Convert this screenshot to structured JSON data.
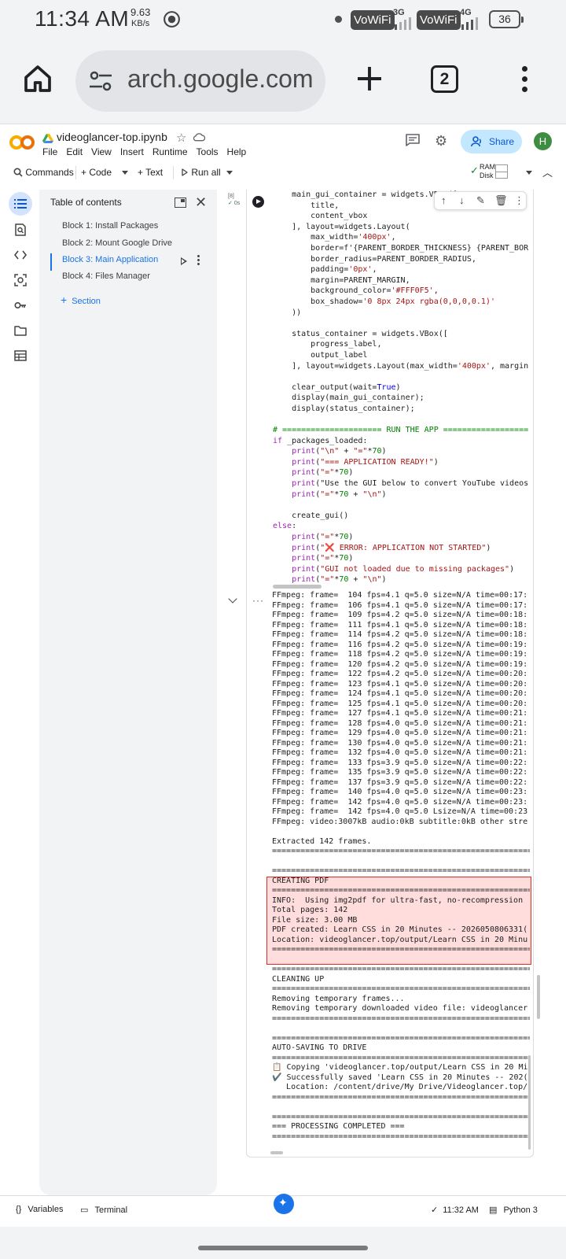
{
  "status_bar": {
    "time": "11:34 AM",
    "net_speed": "9.63",
    "net_unit": "KB/s",
    "sim1_label": "VoWiFi",
    "sim2_label": "VoWiFi",
    "sim1_gen": "3G",
    "sim2_gen": "4G",
    "battery": "36"
  },
  "browser": {
    "url": "arch.google.com",
    "tab_count": "2"
  },
  "colab": {
    "notebook_title": "videoglancer-top.ipynb",
    "menu": [
      "File",
      "Edit",
      "View",
      "Insert",
      "Runtime",
      "Tools",
      "Help"
    ],
    "share_label": "Share",
    "avatar_letter": "H",
    "toolbar": {
      "commands": "Commands",
      "code": "+ Code",
      "text": "+ Text",
      "run_all": "Run all",
      "ram": "RAM",
      "disk": "Disk"
    }
  },
  "toc": {
    "title": "Table of contents",
    "items": [
      "Block 1: Install Packages",
      "Block 2: Mount Google Drive",
      "Block 3: Main Application",
      "Block 4: Files Manager"
    ],
    "active_index": 2,
    "add_section": "Section"
  },
  "cell": {
    "exec_count": "[8]",
    "exec_time": "0s",
    "code_lines": [
      "    main_gui_container = widgets.VBox([",
      "        title,",
      "        content_vbox",
      "    ], layout=widgets.Layout(",
      "        max_width='400px',",
      "        border=f'{PARENT_BORDER_THICKNESS} {PARENT_BOR",
      "        border_radius=PARENT_BORDER_RADIUS,",
      "        padding='0px',",
      "        margin=PARENT_MARGIN,",
      "        background_color='#FFF0F5',",
      "        box_shadow='0 8px 24px rgba(0,0,0,0.1)'",
      "    ))",
      "",
      "    status_container = widgets.VBox([",
      "        progress_label,",
      "        output_label",
      "    ], layout=widgets.Layout(max_width='400px', margin",
      "",
      "    clear_output(wait=True)",
      "    display(main_gui_container);",
      "    display(status_container);",
      "",
      "# ===================== RUN THE APP ==================",
      "if _packages_loaded:",
      "    print(\"\\n\" + \"=\"*70)",
      "    print(\"=== APPLICATION READY!\")",
      "    print(\"=\"*70)",
      "    print(\"Use the GUI below to convert YouTube videos",
      "    print(\"=\"*70 + \"\\n\")",
      "",
      "    create_gui()",
      "else:",
      "    print(\"=\"*70)",
      "    print(\"❌ ERROR: APPLICATION NOT STARTED\")",
      "    print(\"=\"*70)",
      "    print(\"GUI not loaded due to missing packages\")",
      "    print(\"=\"*70 + \"\\n\")"
    ],
    "output_lines": [
      "FFmpeg: frame=  104 fps=4.1 q=5.0 size=N/A time=00:17:",
      "FFmpeg: frame=  106 fps=4.1 q=5.0 size=N/A time=00:17:",
      "FFmpeg: frame=  109 fps=4.2 q=5.0 size=N/A time=00:18:",
      "FFmpeg: frame=  111 fps=4.1 q=5.0 size=N/A time=00:18:",
      "FFmpeg: frame=  114 fps=4.2 q=5.0 size=N/A time=00:18:",
      "FFmpeg: frame=  116 fps=4.2 q=5.0 size=N/A time=00:19:",
      "FFmpeg: frame=  118 fps=4.2 q=5.0 size=N/A time=00:19:",
      "FFmpeg: frame=  120 fps=4.2 q=5.0 size=N/A time=00:19:",
      "FFmpeg: frame=  122 fps=4.2 q=5.0 size=N/A time=00:20:",
      "FFmpeg: frame=  123 fps=4.1 q=5.0 size=N/A time=00:20:",
      "FFmpeg: frame=  124 fps=4.1 q=5.0 size=N/A time=00:20:",
      "FFmpeg: frame=  125 fps=4.1 q=5.0 size=N/A time=00:20:",
      "FFmpeg: frame=  127 fps=4.1 q=5.0 size=N/A time=00:21:",
      "FFmpeg: frame=  128 fps=4.0 q=5.0 size=N/A time=00:21:",
      "FFmpeg: frame=  129 fps=4.0 q=5.0 size=N/A time=00:21:",
      "FFmpeg: frame=  130 fps=4.0 q=5.0 size=N/A time=00:21:",
      "FFmpeg: frame=  132 fps=4.0 q=5.0 size=N/A time=00:21:",
      "FFmpeg: frame=  133 fps=3.9 q=5.0 size=N/A time=00:22:",
      "FFmpeg: frame=  135 fps=3.9 q=5.0 size=N/A time=00:22:",
      "FFmpeg: frame=  137 fps=3.9 q=5.0 size=N/A time=00:22:",
      "FFmpeg: frame=  140 fps=4.0 q=5.0 size=N/A time=00:23:",
      "FFmpeg: frame=  142 fps=4.0 q=5.0 size=N/A time=00:23:",
      "FFmpeg: frame=  142 fps=4.0 q=5.0 Lsize=N/A time=00:23",
      "FFmpeg: video:3007kB audio:0kB subtitle:0kB other stre",
      "",
      "Extracted 142 frames.",
      "=======================================================",
      "",
      "=======================================================",
      "CREATING PDF",
      "=======================================================",
      "INFO:  Using img2pdf for ultra-fast, no-recompression",
      "Total pages: 142",
      "File size: 3.00 MB",
      "PDF created: Learn CSS in 20 Minutes -- 2026050806331(",
      "Location: videoglancer.top/output/Learn CSS in 20 Minu",
      "=======================================================",
      "",
      "=======================================================",
      "CLEANING UP",
      "=======================================================",
      "Removing temporary frames...",
      "Removing temporary downloaded video file: videoglancer",
      "=======================================================",
      "",
      "=======================================================",
      "AUTO-SAVING TO DRIVE",
      "=======================================================",
      "📋 Copying 'videoglancer.top/output/Learn CSS in 20 Mi",
      "✔️ Successfully saved 'Learn CSS in 20 Minutes -- 202(",
      "   Location: /content/drive/My Drive/Videoglancer.top/",
      "=======================================================",
      "",
      "=======================================================",
      "=== PROCESSING COMPLETED ===",
      "======================================================="
    ]
  },
  "bottom_bar": {
    "variables": "Variables",
    "terminal": "Terminal",
    "time": "11:32 AM",
    "runtime": "Python 3"
  }
}
